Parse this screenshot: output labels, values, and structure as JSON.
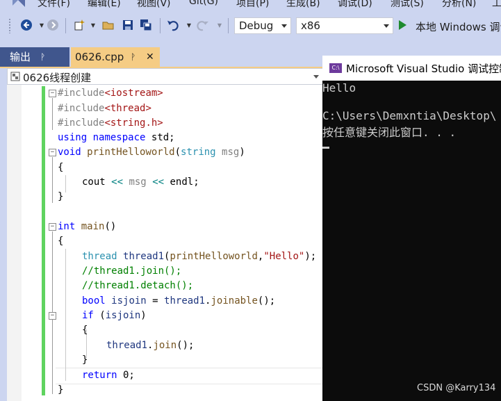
{
  "menu": {
    "items": [
      "文件(F)",
      "编辑(E)",
      "视图(V)",
      "Git(G)",
      "项目(P)",
      "生成(B)",
      "调试(D)",
      "测试(S)",
      "分析(N)",
      "工"
    ]
  },
  "toolbar": {
    "config": "Debug",
    "platform": "x86",
    "run_label": "本地 Windows 调试"
  },
  "tabs": {
    "output": "输出",
    "file": "0626.cpp",
    "pin": "ᚹ",
    "close": "✕"
  },
  "navbar": {
    "scope": "0626线程创建"
  },
  "console": {
    "title": "Microsoft Visual Studio 调试控制台",
    "icon_label": "C:\\",
    "lines": [
      "Hello",
      "",
      "C:\\Users\\Demxntia\\Desktop\\",
      "按任意键关闭此窗口. . ."
    ]
  },
  "watermark": "CSDN @Karry134",
  "colors": {
    "accent_tab": "#f5cc84",
    "inactive_tab": "#40568d",
    "change_bar": "#5fd35f",
    "console_bg": "#0c0c0c"
  }
}
